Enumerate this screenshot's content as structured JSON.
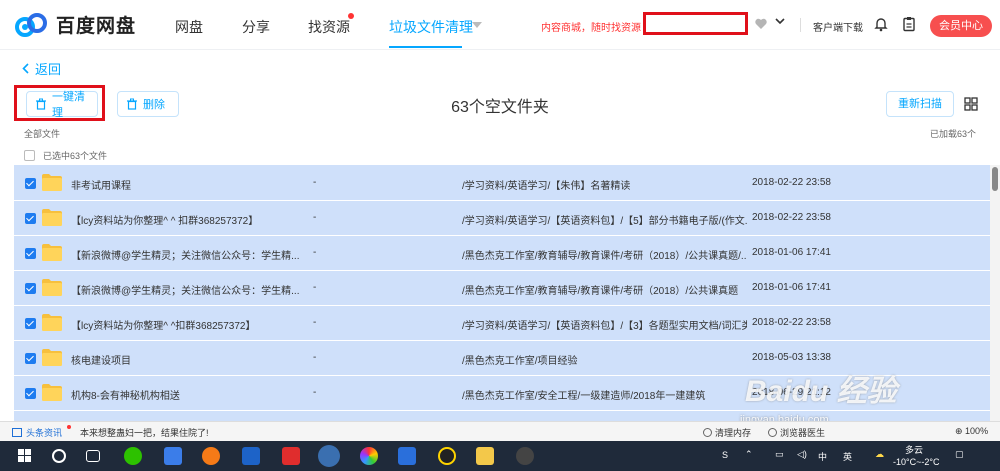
{
  "header": {
    "brand": "百度网盘",
    "tabs": [
      {
        "label": "网盘"
      },
      {
        "label": "分享"
      },
      {
        "label": "找资源"
      },
      {
        "label": "垃圾文件清理"
      }
    ],
    "promo": "内容商城，随时找资源",
    "client_download": "客户端下载",
    "vip_button": "会员中心"
  },
  "page": {
    "back": "返回",
    "one_click_clean": "一键清理",
    "delete": "删除",
    "title": "63个空文件夹",
    "rescan": "重新扫描",
    "all_files": "全部文件",
    "loaded": "已加载63个",
    "selected": "已选中63个文件"
  },
  "files": [
    {
      "name": "非考试用课程",
      "size": "-",
      "path": "/学习资料/英语学习/【朱伟】名著精读",
      "date": "2018-02-22 23:58"
    },
    {
      "name": "【lcy资料站为你整理^ ^ 扣群368257372】",
      "size": "-",
      "path": "/学习资料/英语学习/【英语资料包】/【5】部分书籍电子版/(作文...",
      "date": "2018-02-22 23:58"
    },
    {
      "name": "【新浪微博@学生精灵；关注微信公众号：学生精...",
      "size": "-",
      "path": "/黑色杰克工作室/教育辅导/教育课件/考研（2018）/公共课真题/...",
      "date": "2018-01-06 17:41"
    },
    {
      "name": "【新浪微博@学生精灵；关注微信公众号：学生精...",
      "size": "-",
      "path": "/黑色杰克工作室/教育辅导/教育课件/考研（2018）/公共课真题",
      "date": "2018-01-06 17:41"
    },
    {
      "name": "【lcy资料站为你整理^ ^扣群368257372】",
      "size": "-",
      "path": "/学习资料/英语学习/【英语资料包】/【3】各题型实用文档/词汇类",
      "date": "2018-02-22 23:58"
    },
    {
      "name": "核电建设项目",
      "size": "-",
      "path": "/黑色杰克工作室/项目经验",
      "date": "2018-05-03 13:38"
    },
    {
      "name": "机构8-会有神秘机构相送",
      "size": "-",
      "path": "/黑色杰克工作室/安全工程/一级建造师/2018年一建建筑",
      "date": "2018-06-29 21:12"
    }
  ],
  "statusbar": {
    "news_label": "头条资讯",
    "headline": "本来想整蛊妇一把，结果住院了!",
    "clean_memory": "清理内存",
    "browser_doctor": "浏览器医生",
    "zoom": "100%"
  },
  "watermark": {
    "brand": "Baidu 经验",
    "url": "jingyan.baidu.com"
  },
  "taskbar": {
    "weather": "多云",
    "temperature": "-10°C~-2°C",
    "ime": "中",
    "notif": "S",
    "lang_tray": "英"
  },
  "colors": {
    "accent": "#06a7ff",
    "selected_row": "#cfe0fa",
    "vip": "#f74f4f",
    "annotation": "#e0101a",
    "taskbar": "#1f2a3a"
  }
}
